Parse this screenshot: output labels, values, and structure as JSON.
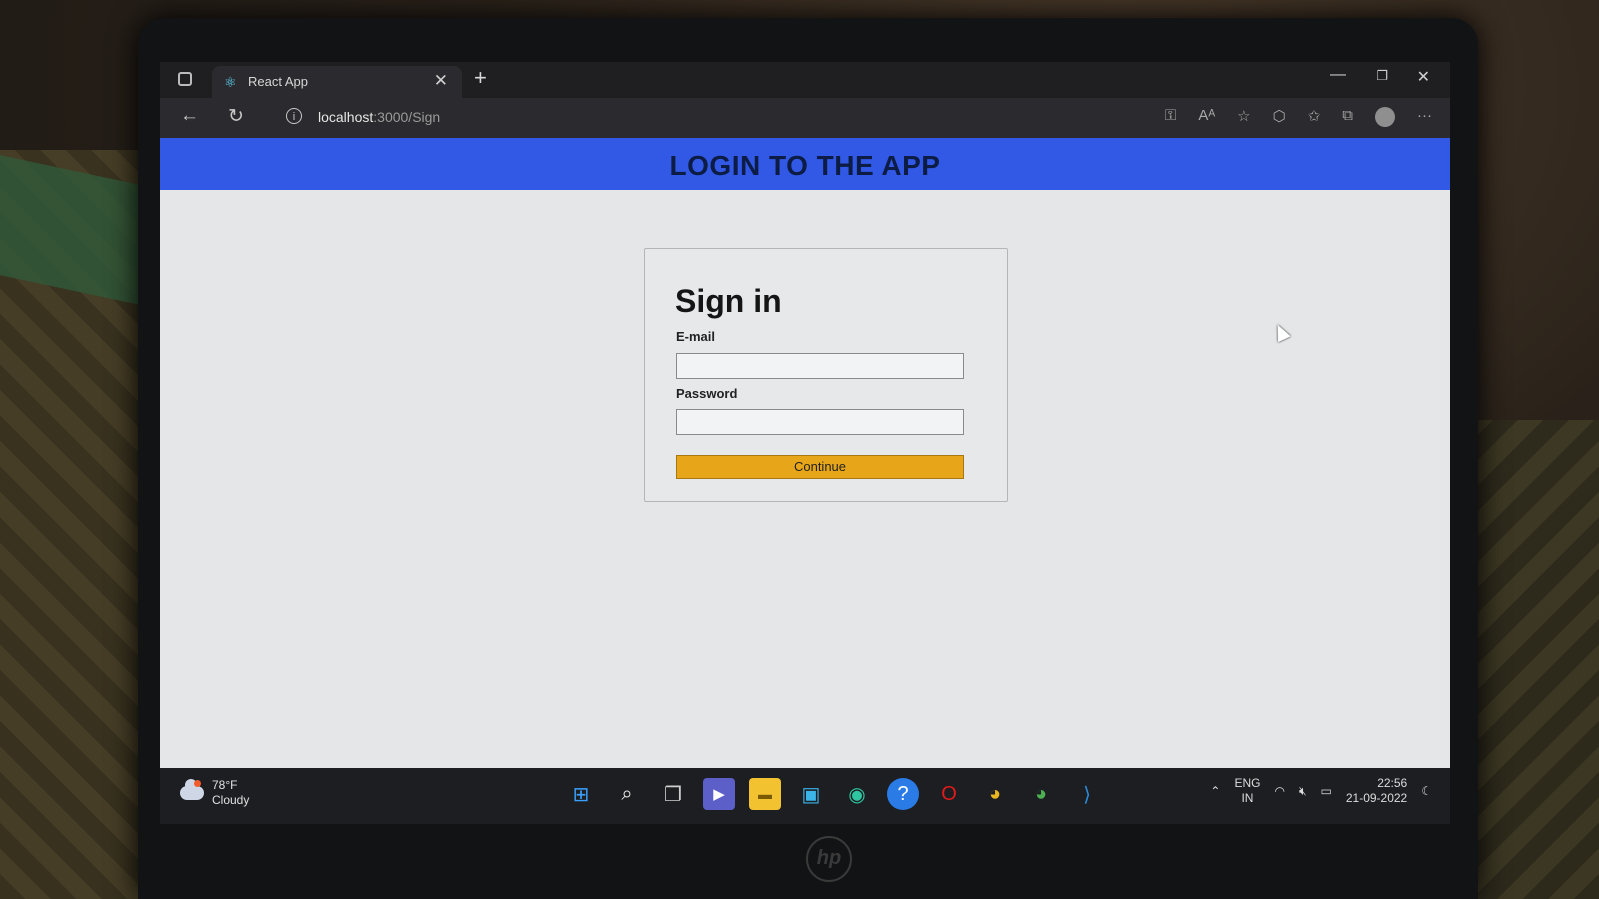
{
  "browser": {
    "tab": {
      "title": "React App",
      "favicon": "react-icon"
    },
    "address": {
      "host": "localhost",
      "path": ":3000/Sign"
    }
  },
  "page": {
    "header": "LOGIN TO THE APP",
    "signin": {
      "title": "Sign in",
      "email_label": "E-mail",
      "email_value": "",
      "password_label": "Password",
      "password_value": "",
      "button_label": "Continue"
    },
    "colors": {
      "header": "#3159e6",
      "button": "#e7a61a"
    }
  },
  "taskbar": {
    "weather": {
      "temp": "78°F",
      "condition": "Cloudy"
    },
    "apps": [
      "windows-start-icon",
      "search-icon",
      "task-view-icon",
      "teams-icon",
      "file-explorer-icon",
      "remote-desktop-icon",
      "edge-icon",
      "help-icon",
      "opera-icon",
      "chrome-icon",
      "chrome-profile-icon",
      "vscode-icon"
    ],
    "language": {
      "line1": "ENG",
      "line2": "IN"
    },
    "clock": {
      "time": "22:56",
      "date": "21-09-2022"
    }
  }
}
